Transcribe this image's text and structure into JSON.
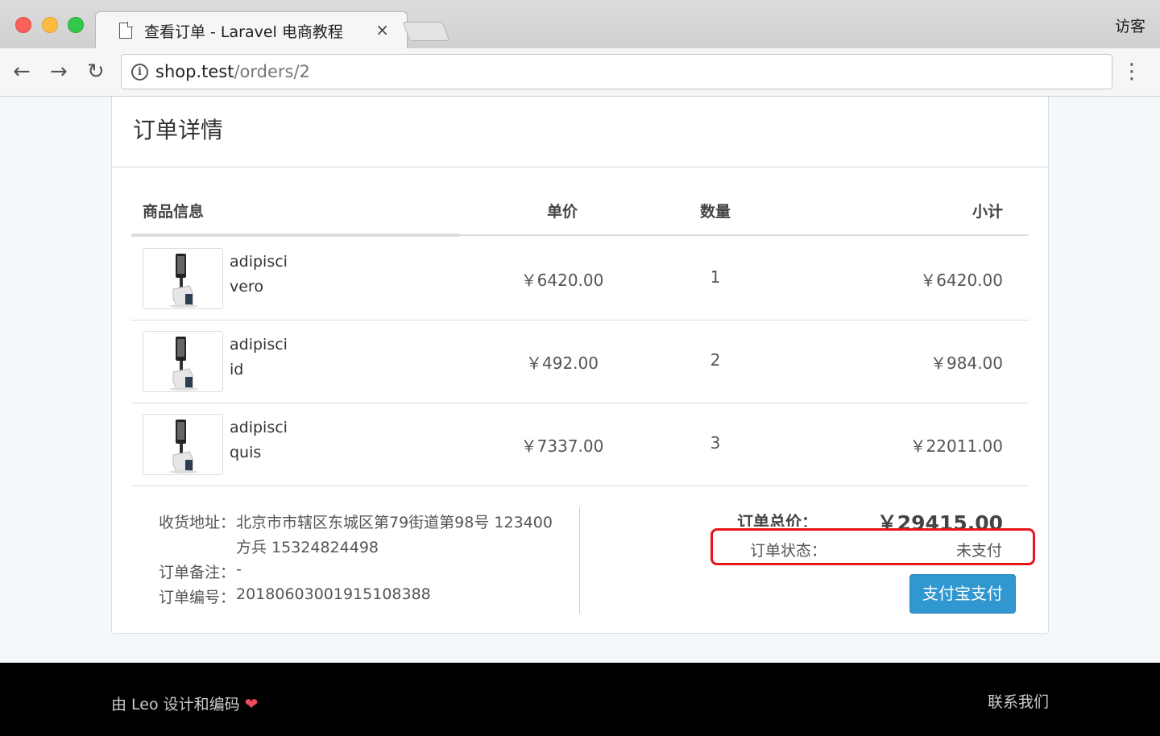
{
  "browser": {
    "tab_title": "查看订单 - Laravel 电商教程",
    "tab_close": "×",
    "profile": "访客",
    "url_host": "shop.test",
    "url_path": "/orders/2",
    "icons": [
      "page-icon",
      "back-arrow-icon",
      "forward-arrow-icon",
      "reload-icon",
      "info-icon",
      "more-menu-icon"
    ]
  },
  "panel": {
    "title": "订单详情"
  },
  "table": {
    "headers": {
      "info": "商品信息",
      "price": "单价",
      "qty": "数量",
      "subtotal": "小计"
    },
    "rows": [
      {
        "name_line1": "adipisci",
        "name_line2": "vero",
        "price": "￥6420.00",
        "qty": "1",
        "subtotal": "￥6420.00"
      },
      {
        "name_line1": "adipisci",
        "name_line2": "id",
        "price": "￥492.00",
        "qty": "2",
        "subtotal": "￥984.00"
      },
      {
        "name_line1": "adipisci",
        "name_line2": "quis",
        "price": "￥7337.00",
        "qty": "3",
        "subtotal": "￥22011.00"
      }
    ]
  },
  "order_info": {
    "address_label": "收货地址：",
    "address_line1": "北京市市辖区东城区第79街道第98号 123400",
    "address_line2": "方兵 15324824498",
    "remark_label": "订单备注：",
    "remark_value": "-",
    "number_label": "订单编号：",
    "number_value": "20180603001915108388"
  },
  "summary": {
    "total_label": "订单总价：",
    "total_value": "￥29415.00",
    "status_label": "订单状态：",
    "status_value": "未支付",
    "pay_button": "支付宝支付",
    "highlight_color": "#e8141a",
    "button_color": "#3097d1"
  },
  "footer": {
    "left_text": "由 Leo 设计和编码",
    "heart": "❤",
    "right_text": "联系我们"
  }
}
